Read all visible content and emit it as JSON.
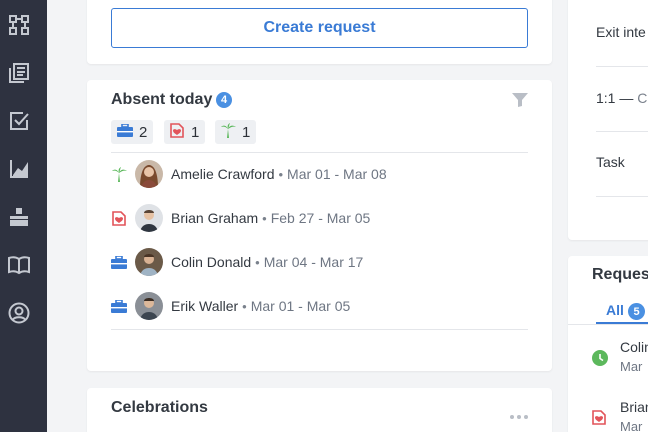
{
  "sidebar": {
    "items": [
      {
        "icon": "workflow-icon"
      },
      {
        "icon": "library-icon"
      },
      {
        "icon": "tasks-icon"
      },
      {
        "icon": "analytics-icon"
      },
      {
        "icon": "org-chart-icon"
      },
      {
        "icon": "book-icon"
      },
      {
        "icon": "profile-icon"
      }
    ]
  },
  "top_card": {
    "create_request_label": "Create request"
  },
  "absent": {
    "title": "Absent today",
    "count": "4",
    "summary": [
      {
        "icon": "briefcase-icon",
        "count": "2"
      },
      {
        "icon": "sick-icon",
        "count": "1"
      },
      {
        "icon": "vacation-icon",
        "count": "1"
      }
    ],
    "people": [
      {
        "icon": "vacation-icon",
        "name": "Amelie Crawford",
        "dates": "Mar 01 - Mar 08"
      },
      {
        "icon": "sick-icon",
        "name": "Brian Graham",
        "dates": "Feb 27 - Mar 05"
      },
      {
        "icon": "briefcase-icon",
        "name": "Colin Donald",
        "dates": "Mar 04 - Mar 17"
      },
      {
        "icon": "briefcase-icon",
        "name": "Erik Waller",
        "dates": "Mar 01 - Mar 05"
      }
    ],
    "separator": "•"
  },
  "celebrations": {
    "title": "Celebrations"
  },
  "right_panel": {
    "items": [
      "Exit inte",
      "1:1 — ",
      "Col",
      "Task"
    ]
  },
  "requests": {
    "title": "Request",
    "tab_all": "All",
    "tab_all_count": "5",
    "rows": [
      {
        "name": "Colin",
        "date": "Mar"
      },
      {
        "name": "Brian",
        "date": "Mar"
      }
    ]
  },
  "colors": {
    "accent": "#3a7bd5",
    "sidebar": "#2e3240",
    "vacation": "#5cb85c",
    "sick": "#e2545a",
    "business": "#3a7bd5"
  }
}
